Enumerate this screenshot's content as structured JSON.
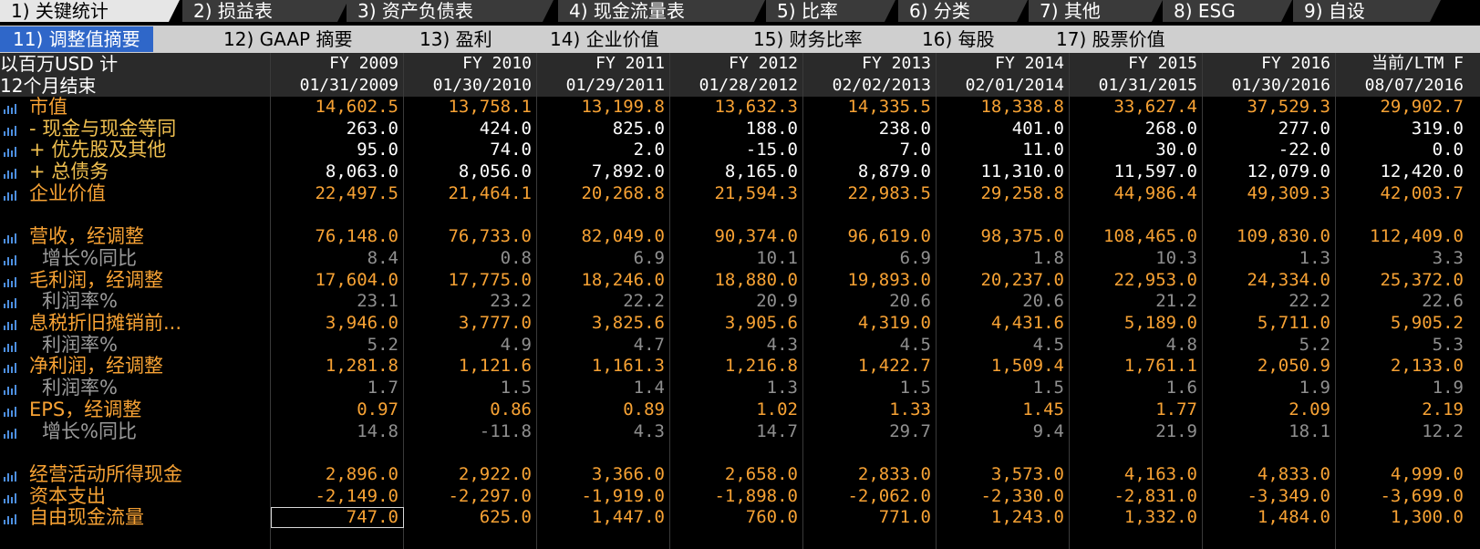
{
  "tabs_top": [
    {
      "label": "1) 关键统计",
      "active": true
    },
    {
      "label": "2) 损益表",
      "active": false
    },
    {
      "label": "3) 资产负债表",
      "active": false
    },
    {
      "label": "4) 现金流量表",
      "active": false
    },
    {
      "label": "5) 比率",
      "active": false
    },
    {
      "label": "6) 分类",
      "active": false
    },
    {
      "label": "7) 其他",
      "active": false
    },
    {
      "label": "8) ESG",
      "active": false
    },
    {
      "label": "9) 自设",
      "active": false
    }
  ],
  "tabs_sub": [
    {
      "label": "11) 调整值摘要",
      "active": true
    },
    {
      "label": "12) GAAP 摘要",
      "active": false
    },
    {
      "label": "13) 盈利",
      "active": false
    },
    {
      "label": "14) 企业价值",
      "active": false
    },
    {
      "label": "15) 财务比率",
      "active": false
    },
    {
      "label": "16) 每股",
      "active": false
    },
    {
      "label": "17) 股票价值",
      "active": false
    }
  ],
  "header": {
    "units_label": "以百万USD 计",
    "period_label": "12个月结束",
    "fiscal_years": [
      "FY 2009",
      "FY 2010",
      "FY 2011",
      "FY 2012",
      "FY 2013",
      "FY 2014",
      "FY 2015",
      "FY 2016",
      "当前/LTM F"
    ],
    "dates": [
      "01/31/2009",
      "01/30/2010",
      "01/29/2011",
      "01/28/2012",
      "02/02/2013",
      "02/01/2014",
      "01/31/2015",
      "01/30/2016",
      "08/07/2016"
    ]
  },
  "rows": [
    {
      "label": "市值",
      "style": "orange",
      "values": [
        "14,602.5",
        "13,758.1",
        "13,199.8",
        "13,632.3",
        "14,335.5",
        "18,338.8",
        "33,627.4",
        "37,529.3",
        "29,902.7"
      ]
    },
    {
      "label": "- 现金与现金等同",
      "style": "white",
      "values": [
        "263.0",
        "424.0",
        "825.0",
        "188.0",
        "238.0",
        "401.0",
        "268.0",
        "277.0",
        "319.0"
      ]
    },
    {
      "label": "+ 优先股及其他",
      "style": "white",
      "values": [
        "95.0",
        "74.0",
        "2.0",
        "-15.0",
        "7.0",
        "11.0",
        "30.0",
        "-22.0",
        "0.0"
      ]
    },
    {
      "label": "+ 总债务",
      "style": "white",
      "values": [
        "8,063.0",
        "8,056.0",
        "7,892.0",
        "8,165.0",
        "8,879.0",
        "11,310.0",
        "11,597.0",
        "12,079.0",
        "12,420.0"
      ]
    },
    {
      "label": "企业价值",
      "style": "orange",
      "values": [
        "22,497.5",
        "21,464.1",
        "20,268.8",
        "21,594.3",
        "22,983.5",
        "29,258.8",
        "44,986.4",
        "49,309.3",
        "42,003.7"
      ]
    },
    {
      "label": "",
      "style": "blank",
      "values": [
        "",
        "",
        "",
        "",
        "",
        "",
        "",
        "",
        ""
      ]
    },
    {
      "label": "营收，经调整",
      "style": "orange",
      "values": [
        "76,148.0",
        "76,733.0",
        "82,049.0",
        "90,374.0",
        "96,619.0",
        "98,375.0",
        "108,465.0",
        "109,830.0",
        "112,409.0"
      ]
    },
    {
      "label": "增长%同比",
      "style": "sub",
      "values": [
        "8.4",
        "0.8",
        "6.9",
        "10.1",
        "6.9",
        "1.8",
        "10.3",
        "1.3",
        "3.3"
      ]
    },
    {
      "label": "毛利润，经调整",
      "style": "orange",
      "values": [
        "17,604.0",
        "17,775.0",
        "18,246.0",
        "18,880.0",
        "19,893.0",
        "20,237.0",
        "22,953.0",
        "24,334.0",
        "25,372.0"
      ]
    },
    {
      "label": "利润率%",
      "style": "sub",
      "values": [
        "23.1",
        "23.2",
        "22.2",
        "20.9",
        "20.6",
        "20.6",
        "21.2",
        "22.2",
        "22.6"
      ]
    },
    {
      "label": "息税折旧摊销前...",
      "style": "orange",
      "values": [
        "3,946.0",
        "3,777.0",
        "3,825.6",
        "3,905.6",
        "4,319.0",
        "4,431.6",
        "5,189.0",
        "5,711.0",
        "5,905.2"
      ]
    },
    {
      "label": "利润率%",
      "style": "sub",
      "values": [
        "5.2",
        "4.9",
        "4.7",
        "4.3",
        "4.5",
        "4.5",
        "4.8",
        "5.2",
        "5.3"
      ]
    },
    {
      "label": "净利润，经调整",
      "style": "orange",
      "values": [
        "1,281.8",
        "1,121.6",
        "1,161.3",
        "1,216.8",
        "1,422.7",
        "1,509.4",
        "1,761.1",
        "2,050.9",
        "2,133.0"
      ]
    },
    {
      "label": "利润率%",
      "style": "sub",
      "values": [
        "1.7",
        "1.5",
        "1.4",
        "1.3",
        "1.5",
        "1.5",
        "1.6",
        "1.9",
        "1.9"
      ]
    },
    {
      "label": "EPS，经调整",
      "style": "orange",
      "values": [
        "0.97",
        "0.86",
        "0.89",
        "1.02",
        "1.33",
        "1.45",
        "1.77",
        "2.09",
        "2.19"
      ]
    },
    {
      "label": "增长%同比",
      "style": "sub",
      "values": [
        "14.8",
        "-11.8",
        "4.3",
        "14.7",
        "29.7",
        "9.4",
        "21.9",
        "18.1",
        "12.2"
      ]
    },
    {
      "label": "",
      "style": "blank",
      "values": [
        "",
        "",
        "",
        "",
        "",
        "",
        "",
        "",
        ""
      ]
    },
    {
      "label": "经营活动所得现金",
      "style": "orange",
      "values": [
        "2,896.0",
        "2,922.0",
        "3,366.0",
        "2,658.0",
        "2,833.0",
        "3,573.0",
        "4,163.0",
        "4,833.0",
        "4,999.0"
      ]
    },
    {
      "label": "资本支出",
      "style": "orange",
      "values": [
        "-2,149.0",
        "-2,297.0",
        "-1,919.0",
        "-1,898.0",
        "-2,062.0",
        "-2,330.0",
        "-2,831.0",
        "-3,349.0",
        "-3,699.0"
      ]
    },
    {
      "label": "自由现金流量",
      "style": "orange",
      "values": [
        "747.0",
        "625.0",
        "1,447.0",
        "760.0",
        "771.0",
        "1,243.0",
        "1,332.0",
        "1,484.0",
        "1,300.0"
      ]
    }
  ],
  "selected_cell": {
    "row": 19,
    "col": 0
  },
  "colors": {
    "accent": "#f7a234",
    "active_tab": "#2f67c9",
    "chart_icon": "#4d8fe0"
  }
}
